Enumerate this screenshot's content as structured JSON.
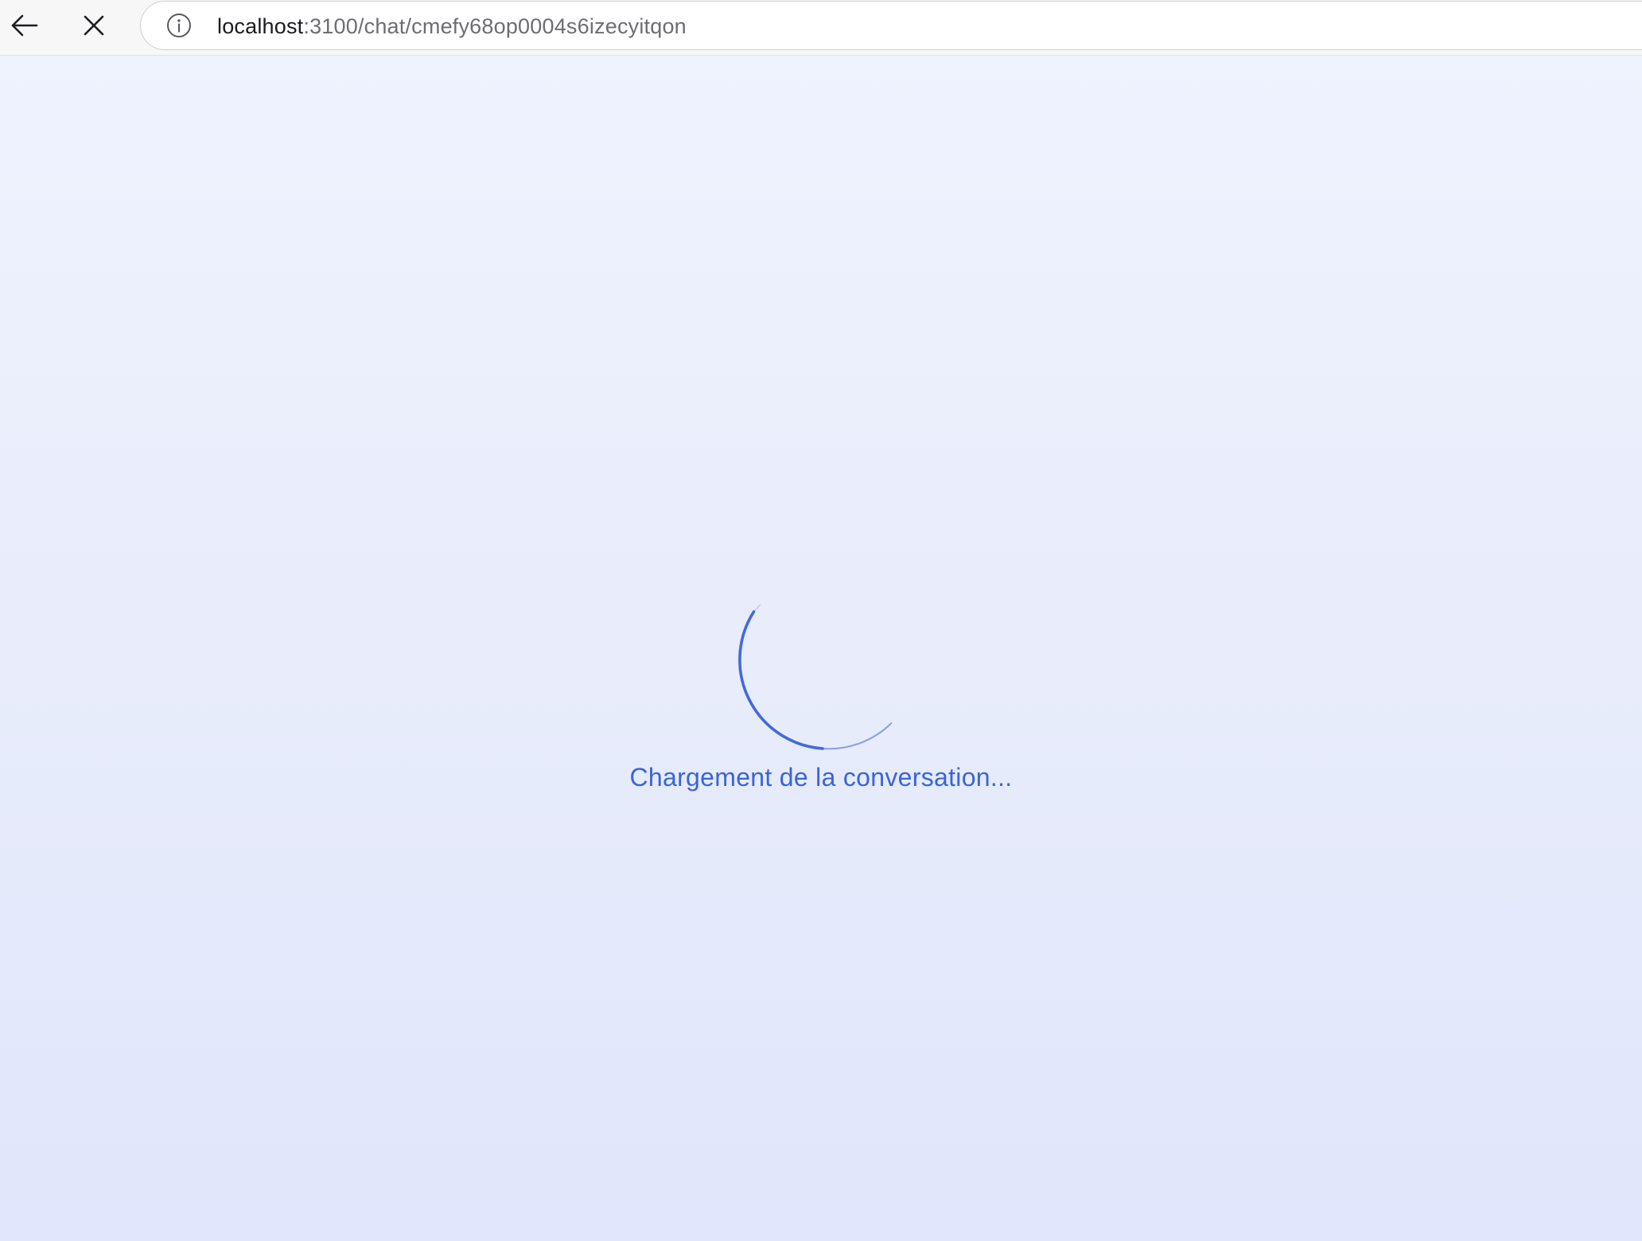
{
  "browser": {
    "url_host": "localhost",
    "url_rest": ":3100/chat/cmefy68op0004s6izecyitqon",
    "icons": {
      "back": "arrow-left-icon",
      "stop": "close-icon",
      "site_info": "info-icon"
    }
  },
  "page": {
    "loading_text": "Chargement de la conversation...",
    "accent_color": "#3a64d8",
    "background_top": "#eff3fe",
    "background_bottom": "#e0e6fb"
  }
}
